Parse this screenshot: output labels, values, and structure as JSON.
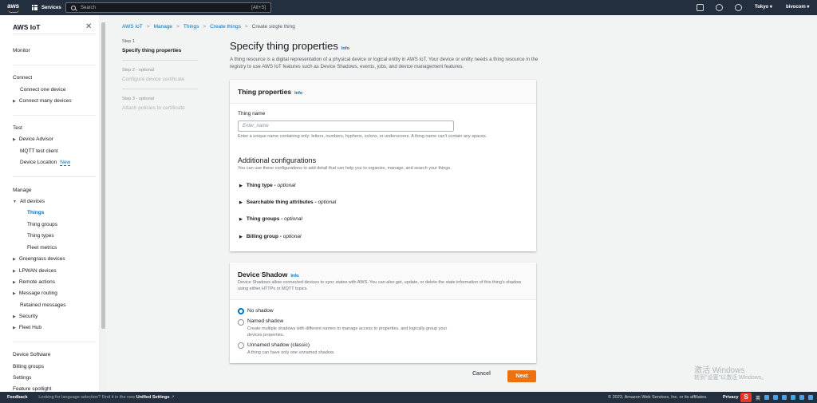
{
  "topnav": {
    "logo_text": "aws",
    "services_label": "Services",
    "search_placeholder": "Search",
    "search_shortcut": "[Alt+S]",
    "region": "Tokyo ▾",
    "account": "bivocom ▾"
  },
  "sidebar": {
    "title": "AWS IoT",
    "items": {
      "monitor": "Monitor",
      "connect": "Connect",
      "connect_one": "Connect one device",
      "connect_many": "Connect many devices",
      "test": "Test",
      "device_advisor": "Device Advisor",
      "mqtt": "MQTT test client",
      "device_location": "Device Location",
      "new_badge": "New",
      "manage": "Manage",
      "all_devices": "All devices",
      "things": "Things",
      "thing_groups": "Thing groups",
      "thing_types": "Thing types",
      "fleet_metrics": "Fleet metrics",
      "greengrass": "Greengrass devices",
      "lpwan": "LPWAN devices",
      "remote_actions": "Remote actions",
      "message_routing": "Message routing",
      "retained": "Retained messages",
      "security": "Security",
      "fleet_hub": "Fleet Hub",
      "device_software": "Device Software",
      "billing_groups": "Billing groups",
      "settings": "Settings",
      "feature_spotlight": "Feature spotlight"
    }
  },
  "breadcrumb": {
    "items": [
      "AWS IoT",
      "Manage",
      "Things",
      "Create things"
    ],
    "current": "Create single thing"
  },
  "steps": [
    {
      "label": "Step 1",
      "title": "Specify thing properties"
    },
    {
      "label": "Step 2 - optional",
      "title": "Configure device certificate"
    },
    {
      "label": "Step 3 - optional",
      "title": "Attach policies to certificate"
    }
  ],
  "main": {
    "title": "Specify thing properties",
    "info": "Info",
    "description": "A thing resource is a digital representation of a physical device or logical entity in AWS IoT. Your device or entity needs a thing resource in the registry to use AWS IoT features such as Device Shadows, events, jobs, and device management features.",
    "props": {
      "title": "Thing properties",
      "info": "Info",
      "name_label": "Thing name",
      "name_placeholder": "Enter_name",
      "name_hint": "Enter a unique name containing only: letters, numbers, hyphens, colons, or underscores. A thing name can't contain any spaces.",
      "additional_title": "Additional configurations",
      "additional_desc": "You can use these configurations to add detail that can help you to organize, manage, and search your things.",
      "optional": "optional",
      "expanders": [
        "Thing type",
        "Searchable thing attributes",
        "Thing groups",
        "Billing group"
      ]
    },
    "shadow": {
      "title": "Device Shadow",
      "info": "Info",
      "desc": "Device Shadows allow connected devices to sync states with AWS. You can also get, update, or delete the state information of this thing's shadow using either HTTPs or MQTT topics.",
      "options": [
        {
          "label": "No shadow",
          "hint": ""
        },
        {
          "label": "Named shadow",
          "hint": "Create multiple shadows with different names to manage access to properties, and logically group your devices properties."
        },
        {
          "label": "Unnamed shadow (classic)",
          "hint": "A thing can have only one unnamed shadow."
        }
      ],
      "selected": "No shadow"
    },
    "cancel": "Cancel",
    "next": "Next"
  },
  "watermark": {
    "line1": "激活 Windows",
    "line2": "转到\"设置\"以激活 Windows。"
  },
  "footer": {
    "feedback": "Feedback",
    "lang_text": "Looking for language selection? Find it in the new",
    "lang_link": "Unified Settings",
    "copyright": "© 2023, Amazon Web Services, Inc. or its affiliates.",
    "privacy": "Privacy",
    "ime_logo": "S",
    "ime_label": "英"
  },
  "colors": {
    "nav_bg": "#232f3e",
    "link": "#0073bb",
    "primary": "#ec7211"
  }
}
